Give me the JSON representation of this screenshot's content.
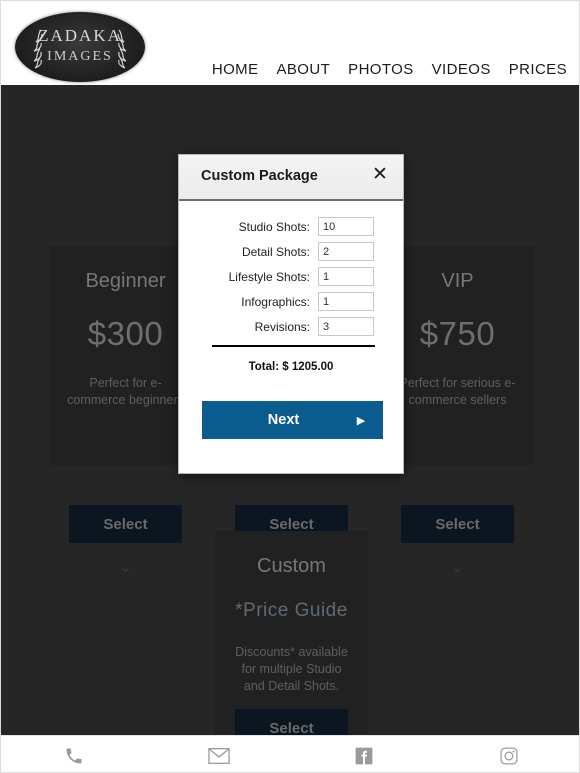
{
  "header": {
    "logo": {
      "line1": "ZADAKA",
      "line2": "IMAGES",
      "icon": "antler-icon"
    },
    "nav": [
      {
        "label": "HOME"
      },
      {
        "label": "ABOUT"
      },
      {
        "label": "PHOTOS"
      },
      {
        "label": "VIDEOS"
      },
      {
        "label": "PRICES"
      }
    ]
  },
  "pricing": {
    "cards": [
      {
        "title": "Beginner",
        "price": "$300",
        "description": "Perfect for e-commerce beginners",
        "select_label": "Select",
        "chevron": "⌄"
      },
      {
        "title": "",
        "price": "",
        "description": "",
        "select_label": "Select",
        "chevron": "⌄"
      },
      {
        "title": "VIP",
        "price": "$750",
        "description": "Perfect for serious e-commerce sellers",
        "select_label": "Select",
        "chevron": "⌄"
      },
      {
        "title": "Custom",
        "price": "*Price Guide",
        "description": "Discounts* available for multiple Studio and Detail Shots.",
        "select_label": "Select",
        "chevron": ""
      }
    ]
  },
  "modal": {
    "title": "Custom Package",
    "close_icon": "✕",
    "fields": [
      {
        "label": "Studio Shots:",
        "value": "10"
      },
      {
        "label": "Detail Shots:",
        "value": "2"
      },
      {
        "label": "Lifestyle Shots:",
        "value": "1"
      },
      {
        "label": "Infographics:",
        "value": "1"
      },
      {
        "label": "Revisions:",
        "value": "3"
      }
    ],
    "total": "Total: $ 1205.00",
    "next_label": "Next",
    "next_arrow": "▶",
    "accent_color": "#0b5c8e"
  },
  "footer": {
    "icons": [
      {
        "name": "phone-icon"
      },
      {
        "name": "email-icon"
      },
      {
        "name": "facebook-icon"
      },
      {
        "name": "instagram-icon"
      }
    ]
  }
}
